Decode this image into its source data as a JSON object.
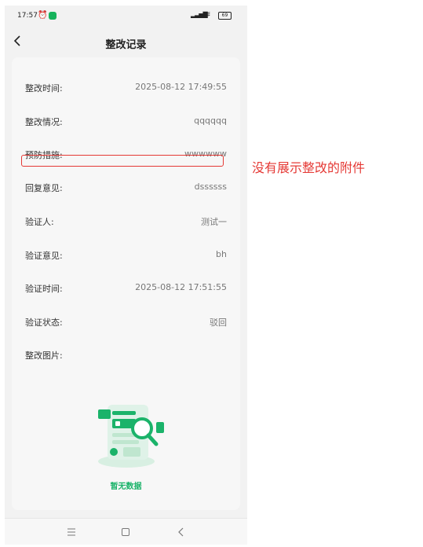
{
  "status_bar": {
    "time": "17:57",
    "battery": "69"
  },
  "header": {
    "title": "整改记录"
  },
  "records": [
    {
      "label": "整改时间:",
      "value": "2025-08-12 17:49:55"
    },
    {
      "label": "整改情况:",
      "value": "qqqqqq"
    },
    {
      "label": "预防措施:",
      "value": "wwwwww"
    },
    {
      "label": "回复意见:",
      "value": "dssssss"
    },
    {
      "label": "验证人:",
      "value": "测试一"
    },
    {
      "label": "验证意见:",
      "value": "bh"
    },
    {
      "label": "验证时间:",
      "value": "2025-08-12 17:51:55"
    },
    {
      "label": "验证状态:",
      "value": "驳回"
    },
    {
      "label": "整改图片:",
      "value": ""
    }
  ],
  "empty_state": {
    "text": "暂无数据",
    "icon": "empty-search-illustration"
  },
  "annotation": {
    "text": "没有展示整改的附件",
    "color": "#e53935"
  },
  "colors": {
    "accent_green": "#1bb36a",
    "highlight_red": "#e53935"
  }
}
